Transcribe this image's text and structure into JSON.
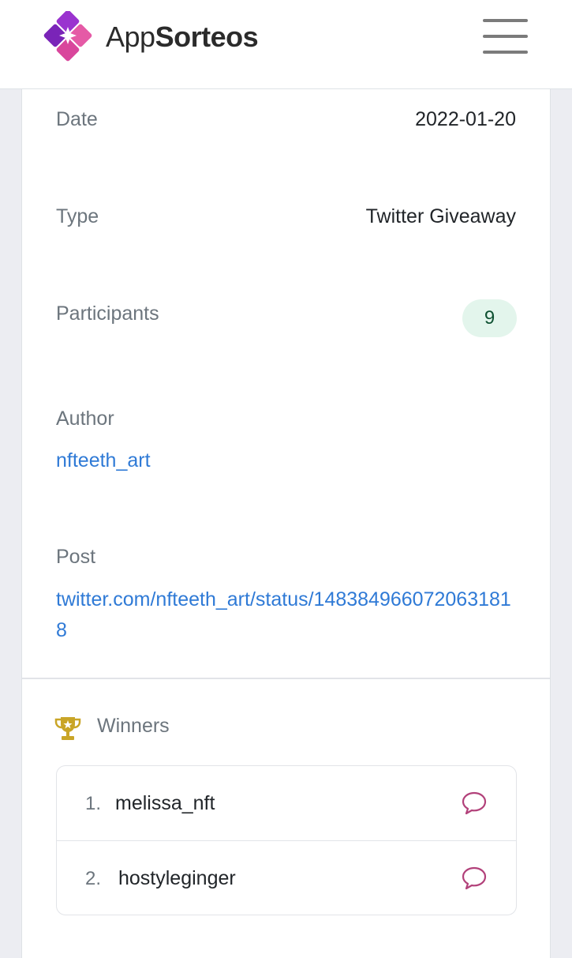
{
  "header": {
    "brand_part1": "App",
    "brand_part2": "Sorteos",
    "logo_icon": "appsorteos-logo-icon",
    "menu_icon": "hamburger-menu-icon"
  },
  "details": {
    "date_label": "Date",
    "date_value": "2022-01-20",
    "type_label": "Type",
    "type_value": "Twitter Giveaway",
    "participants_label": "Participants",
    "participants_value": "9",
    "author_label": "Author",
    "author_value": "nfteeth_art",
    "post_label": "Post",
    "post_value": "twitter.com/nfteeth_art/status/1483849660720631818"
  },
  "winners": {
    "title": "Winners",
    "icon": "trophy-icon",
    "items": [
      {
        "rank": "1.",
        "name": "melissa_nft",
        "icon": "comment-icon"
      },
      {
        "rank": "2.",
        "name": "hostyleginger",
        "icon": "comment-icon"
      }
    ]
  },
  "colors": {
    "link": "#2f7ad6",
    "badge_bg": "#e3f5ec",
    "badge_text": "#0f5132",
    "trophy": "#c9a527",
    "comment_icon": "#b2417a",
    "brand_gradient_start": "#8e2bd0",
    "brand_gradient_end": "#e2499b"
  }
}
